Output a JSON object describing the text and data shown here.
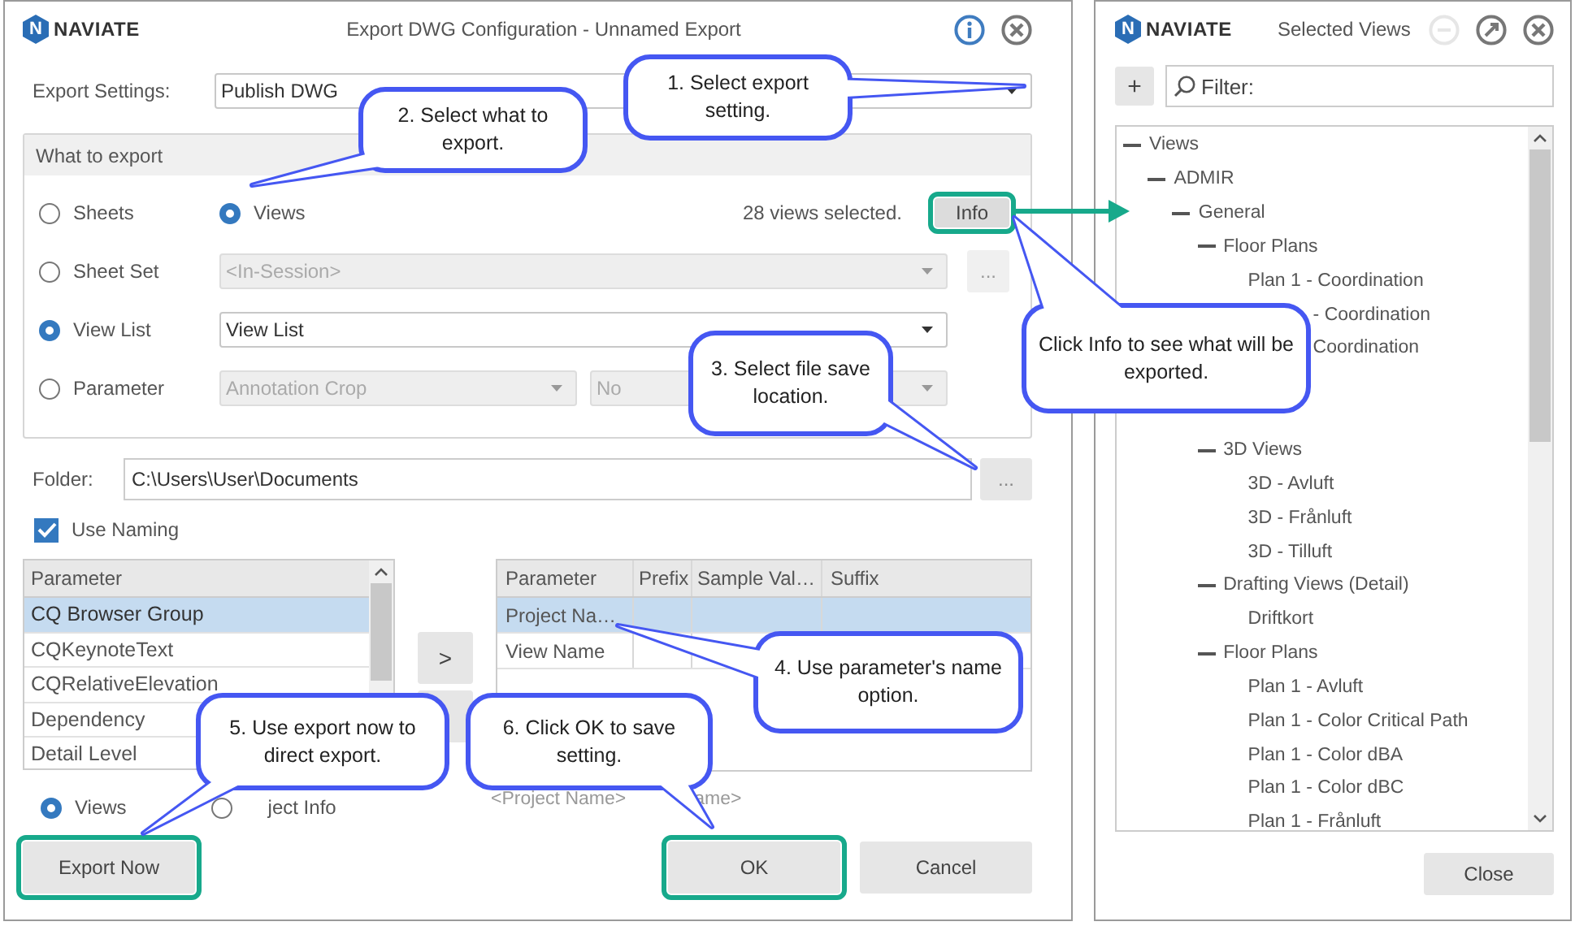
{
  "export_dialog": {
    "logo": {
      "mark": "N",
      "name": "NAVIATE"
    },
    "title": "Export DWG Configuration - Unnamed Export",
    "export_settings": {
      "label": "Export Settings:",
      "value": "Publish DWG"
    },
    "what_to_export": {
      "title": "What to export",
      "sheets": {
        "label": "Sheets",
        "selected": false
      },
      "views": {
        "label": "Views",
        "selected": true
      },
      "views_count": "28 views selected.",
      "info_button": {
        "label": "Info",
        "highlighted": true
      },
      "sheet_set": {
        "label": "Sheet Set",
        "selected": false,
        "value": "<In-Session>",
        "disabled": true,
        "browse": "..."
      },
      "view_list": {
        "label": "View List",
        "selected": true,
        "value": "View List",
        "disabled": false
      },
      "parameter": {
        "label": "Parameter",
        "selected": false,
        "value": "Annotation Crop",
        "value_2": "No",
        "disabled": true
      }
    },
    "folder": {
      "label": "Folder:",
      "value": "C:\\Users\\User\\Documents",
      "browse": "..."
    },
    "use_naming": {
      "label": "Use Naming",
      "checked": true
    },
    "parameter_list": {
      "header": "Parameter",
      "rows": [
        {
          "label": "CQ Browser Group",
          "selected": true
        },
        {
          "label": "CQKeynoteText",
          "selected": false
        },
        {
          "label": "CQRelativeElevation",
          "selected": false
        },
        {
          "label": "Dependency",
          "selected": false
        },
        {
          "label": "Detail Level",
          "selected": false
        }
      ]
    },
    "add_button": ">",
    "naming_table": {
      "columns": [
        "Parameter",
        "Prefix",
        "Sample Val…",
        "Suffix"
      ],
      "rows": [
        {
          "cells": [
            "Project Na…"
          ],
          "selected": true
        },
        {
          "cells": [
            "View Name"
          ],
          "selected": false
        }
      ]
    },
    "source": [
      {
        "label": "Views",
        "selected": true
      },
      {
        "label": "ject Info",
        "selected": false
      }
    ],
    "naming_preview": [
      "<Project Name>",
      "ame>"
    ],
    "buttons": [
      {
        "label": "Export Now",
        "highlighted": true
      },
      {
        "label": "OK",
        "highlighted": true
      },
      {
        "label": "Cancel",
        "highlighted": false
      }
    ]
  },
  "selected_views": {
    "logo": {
      "mark": "N",
      "name": "NAVIATE"
    },
    "title": "Selected Views",
    "add_button": "+",
    "filter": {
      "placeholder": "Filter:"
    },
    "tree": [
      {
        "label": "Views",
        "expanded": true,
        "children": [
          {
            "label": "ADMIR",
            "expanded": true,
            "children": [
              {
                "label": "General",
                "expanded": true,
                "children": [
                  {
                    "label": "Floor Plans",
                    "expanded": true,
                    "children": [
                      {
                        "label": "Plan 1 - Coordination",
                        "clipped": false
                      },
                      {
                        "label": "- Coordination",
                        "clipped": true
                      },
                      {
                        "label": "Coordination",
                        "clipped": true
                      }
                    ]
                  }
                ]
              }
            ]
          },
          {
            "children": [
              {
                "children": [
                  {
                    "label": "3D Views",
                    "expanded": true,
                    "children": [
                      {
                        "label": "3D - Avluft",
                        "clipped": false
                      },
                      {
                        "label": "3D - Frånluft",
                        "clipped": false
                      },
                      {
                        "label": "3D - Tilluft",
                        "clipped": false
                      }
                    ]
                  },
                  {
                    "label": "Drafting Views (Detail)",
                    "expanded": true,
                    "children": [
                      {
                        "label": "Driftkort",
                        "clipped": false
                      }
                    ]
                  },
                  {
                    "label": "Floor Plans",
                    "expanded": true,
                    "children": [
                      {
                        "label": "Plan 1 - Avluft",
                        "clipped": false
                      },
                      {
                        "label": "Plan 1 - Color Critical Path",
                        "clipped": false
                      },
                      {
                        "label": "Plan 1 - Color dBA",
                        "clipped": false
                      },
                      {
                        "label": "Plan 1 - Color dBC",
                        "clipped": false
                      },
                      {
                        "label": "Plan 1 - Frånluft",
                        "clipped": false
                      }
                    ]
                  }
                ]
              }
            ]
          }
        ]
      }
    ],
    "close_button": "Close"
  },
  "callouts": [
    {
      "text": "1. Select export setting."
    },
    {
      "text": "2. Select what to export."
    },
    {
      "text": "3. Select file save location."
    },
    {
      "text": "Click Info to see what will be exported."
    },
    {
      "text": "4. Use parameter's name option."
    },
    {
      "text": "5. Use export now to direct export."
    },
    {
      "text": "6. Click OK to save setting."
    }
  ]
}
